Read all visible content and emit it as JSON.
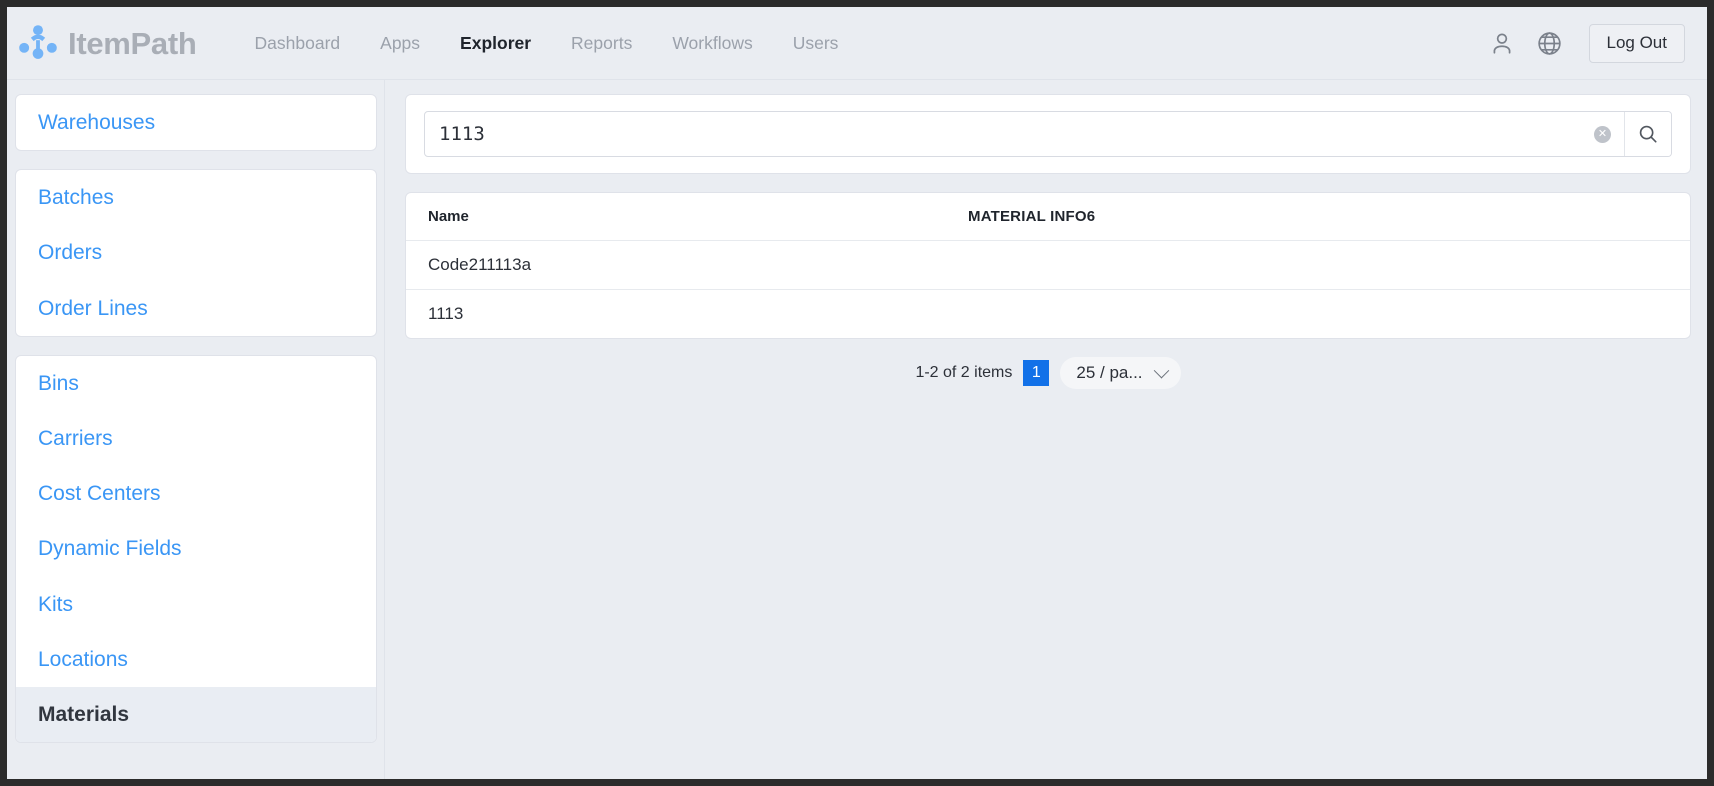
{
  "header": {
    "brand": "ItemPath",
    "logo_icon": "itempath-cluster-logo",
    "nav": [
      {
        "label": "Dashboard",
        "active": false
      },
      {
        "label": "Apps",
        "active": false
      },
      {
        "label": "Explorer",
        "active": true
      },
      {
        "label": "Reports",
        "active": false
      },
      {
        "label": "Workflows",
        "active": false
      },
      {
        "label": "Users",
        "active": false
      }
    ],
    "user_icon": "user-icon",
    "language_icon": "globe-icon",
    "logout_label": "Log Out"
  },
  "sidebar": {
    "groups": [
      {
        "items": [
          {
            "label": "Warehouses",
            "active": false
          }
        ]
      },
      {
        "items": [
          {
            "label": "Batches",
            "active": false
          },
          {
            "label": "Orders",
            "active": false
          },
          {
            "label": "Order Lines",
            "active": false
          }
        ]
      },
      {
        "items": [
          {
            "label": "Bins",
            "active": false
          },
          {
            "label": "Carriers",
            "active": false
          },
          {
            "label": "Cost Centers",
            "active": false
          },
          {
            "label": "Dynamic Fields",
            "active": false
          },
          {
            "label": "Kits",
            "active": false
          },
          {
            "label": "Locations",
            "active": false
          },
          {
            "label": "Materials",
            "active": true
          }
        ]
      }
    ]
  },
  "search": {
    "value": "1113",
    "placeholder": "",
    "clear_icon": "clear-circle-x-icon",
    "clear_glyph": "✕",
    "search_icon": "magnifier-icon"
  },
  "table": {
    "columns": [
      {
        "key": "name",
        "label": "Name"
      },
      {
        "key": "material_info6",
        "label": "MATERIAL INFO6"
      }
    ],
    "rows": [
      {
        "name": "Code211113a",
        "material_info6": ""
      },
      {
        "name": "1113",
        "material_info6": ""
      }
    ]
  },
  "pagination": {
    "summary": "1-2 of 2 items",
    "current_page": "1",
    "page_size_label": "25 / pa...",
    "chevron_icon": "chevron-down-icon"
  },
  "colors": {
    "accent_blue": "#3a96f5",
    "page_active_blue": "#1271e8",
    "background": "#eaedf2",
    "card": "#ffffff",
    "muted_text": "#9ba1ab"
  }
}
